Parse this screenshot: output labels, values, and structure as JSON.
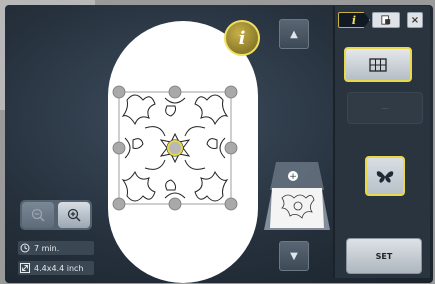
{
  "info_button": {
    "glyph": "i"
  },
  "scroll": {
    "up_glyph": "▲",
    "down_glyph": "▼"
  },
  "zoom": {
    "out_icon": "zoom-out-icon",
    "in_icon": "zoom-in-icon"
  },
  "status": {
    "time": "7 min.",
    "size": "4.4x4.4 inch"
  },
  "preview": {
    "badge_glyph": "+"
  },
  "panel": {
    "tab_info": "i",
    "close_glyph": "×",
    "set_label": "SET",
    "disabled_label": "—",
    "grid_icon": "grid-icon",
    "butterfly_icon": "butterfly-icon"
  },
  "colors": {
    "accent": "#e8d84a",
    "background": "#26313d",
    "hoop": "#ffffff"
  }
}
